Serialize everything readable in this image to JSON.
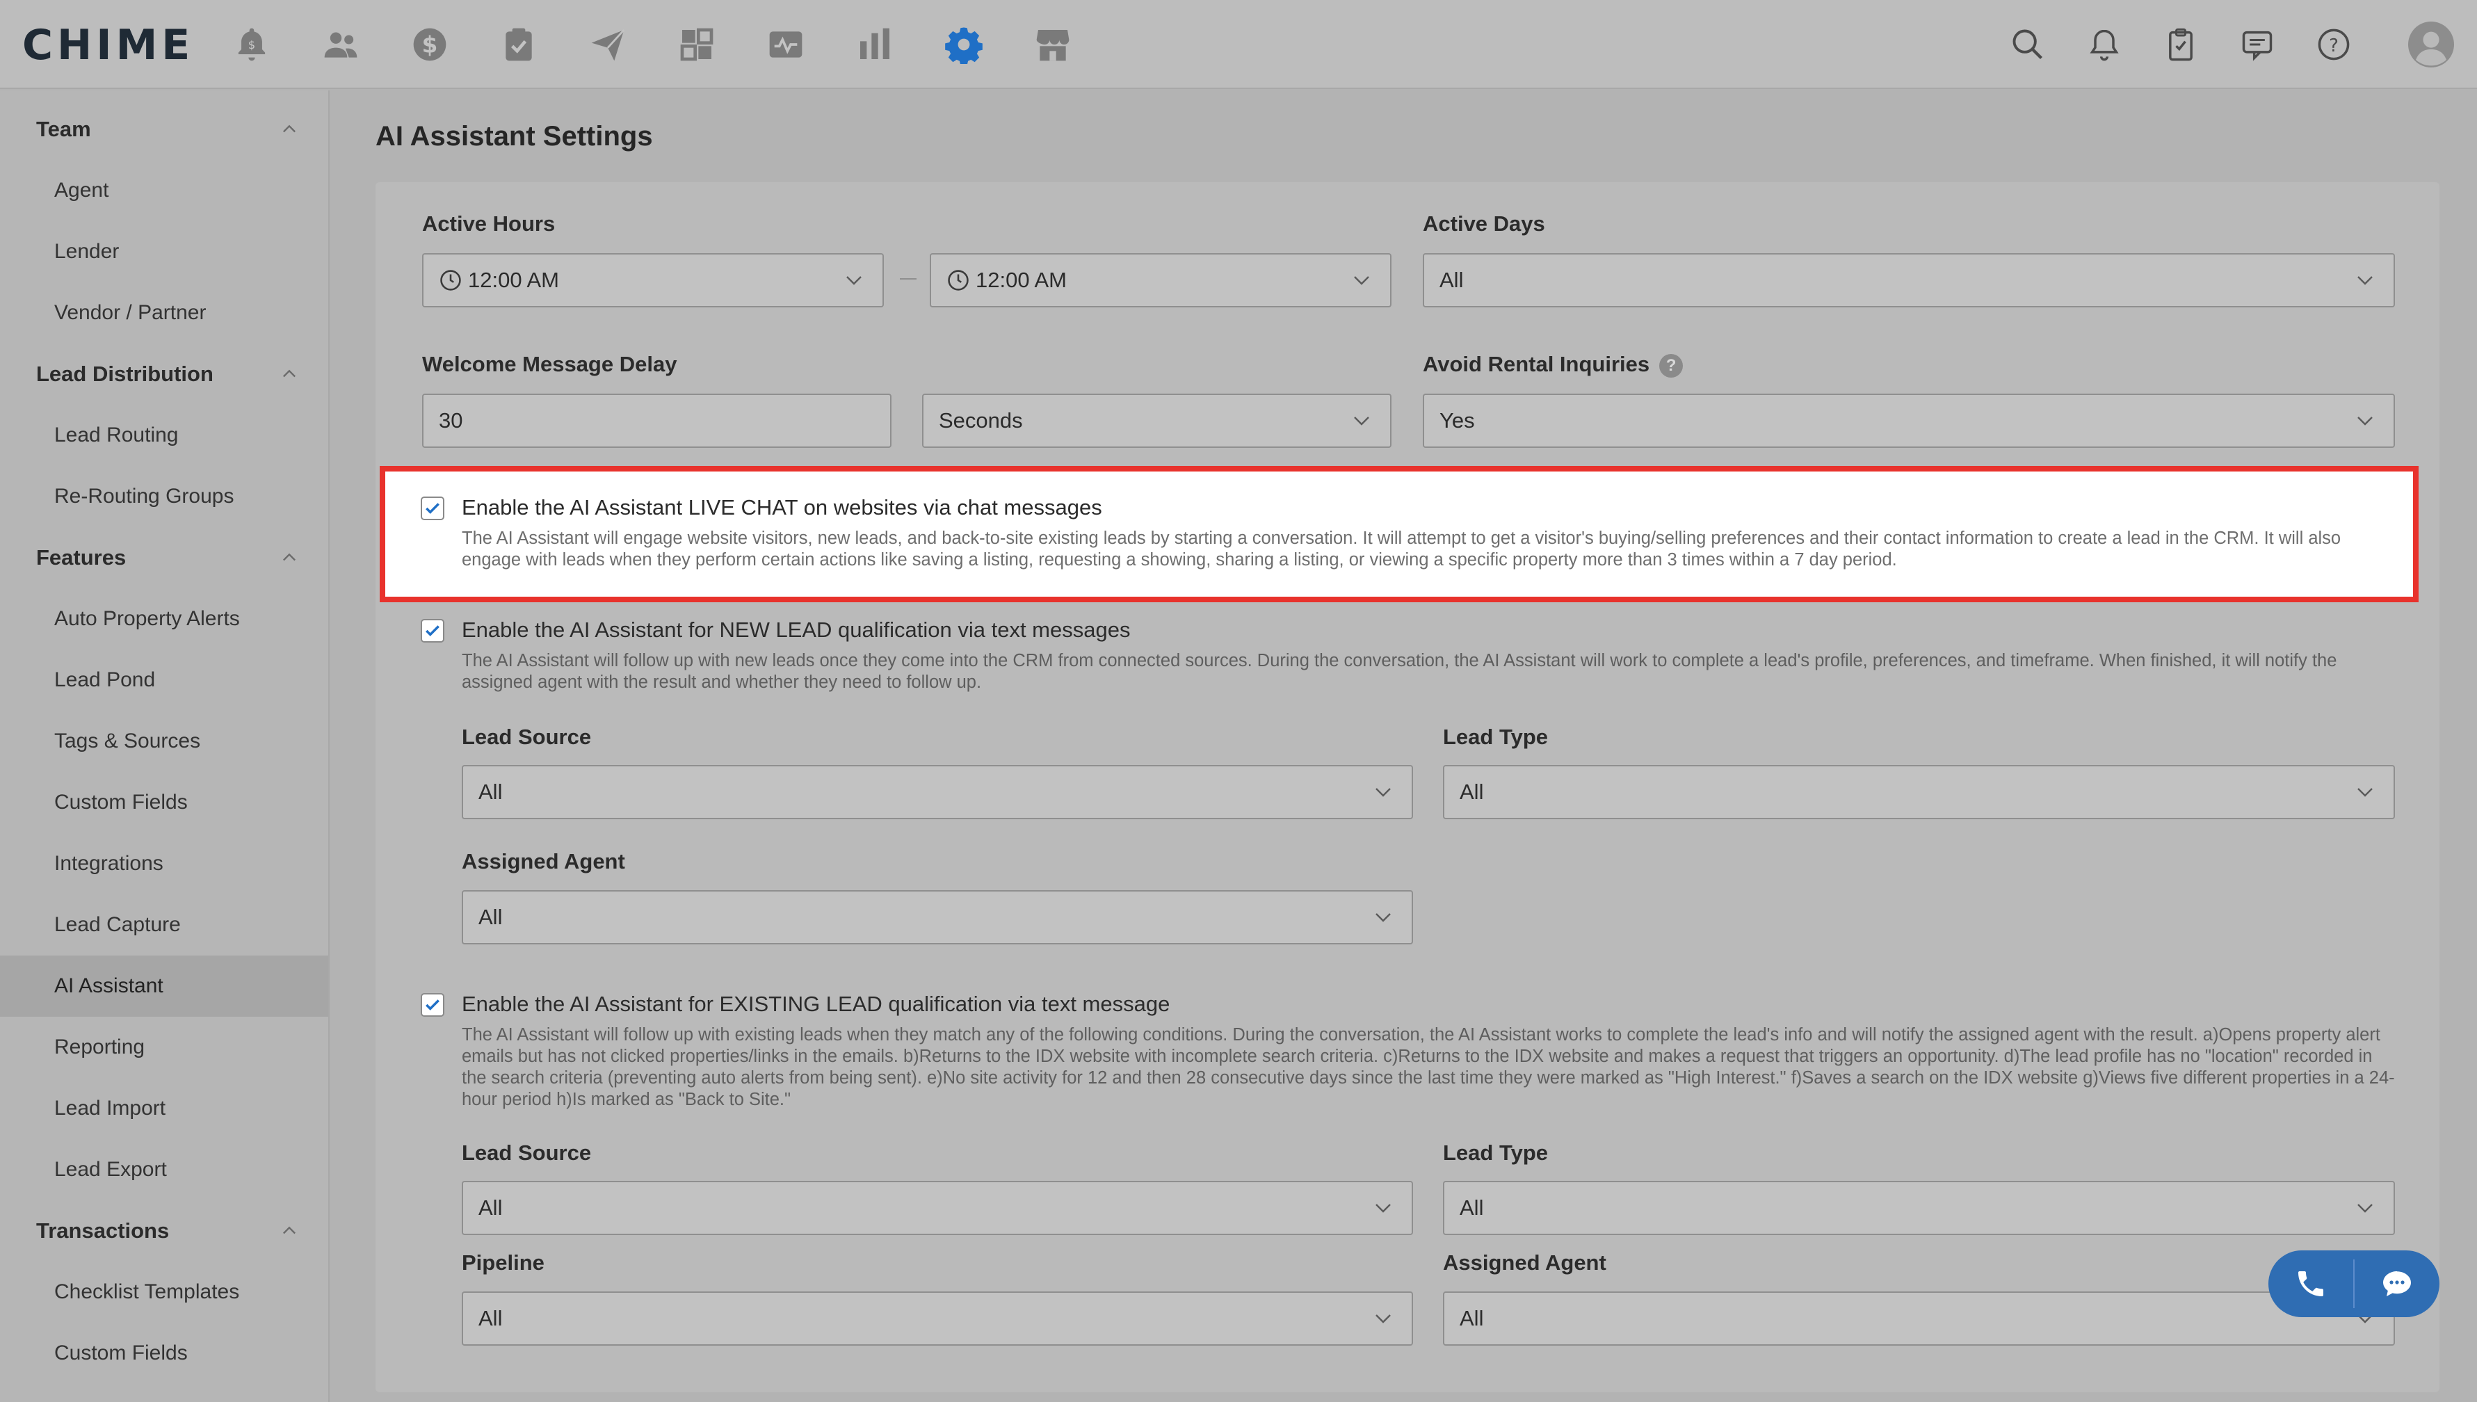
{
  "app": {
    "logo": "CHIME"
  },
  "top_nav": {
    "icons": [
      "bell-dollar-icon",
      "people-icon",
      "dollar-icon",
      "clipboard-check-icon",
      "send-icon",
      "dashboard-icon",
      "activity-icon",
      "bar-chart-icon",
      "gear-icon",
      "store-icon"
    ],
    "active": "gear-icon",
    "right_icons": [
      "search-icon",
      "notification-bell-icon",
      "task-clipboard-icon",
      "message-icon",
      "help-icon",
      "avatar"
    ]
  },
  "sidebar": {
    "sections": [
      {
        "title": "Team",
        "items": [
          "Agent",
          "Lender",
          "Vendor / Partner"
        ]
      },
      {
        "title": "Lead Distribution",
        "items": [
          "Lead Routing",
          "Re-Routing Groups"
        ]
      },
      {
        "title": "Features",
        "items": [
          "Auto Property Alerts",
          "Lead Pond",
          "Tags & Sources",
          "Custom Fields",
          "Integrations",
          "Lead Capture",
          "AI Assistant",
          "Reporting",
          "Lead Import",
          "Lead Export"
        ]
      },
      {
        "title": "Transactions",
        "items": [
          "Checklist Templates",
          "Custom Fields"
        ]
      }
    ],
    "active_item": "AI Assistant"
  },
  "page": {
    "title": "AI Assistant Settings",
    "active_hours": {
      "label": "Active Hours",
      "start": "12:00 AM",
      "end": "12:00 AM"
    },
    "active_days": {
      "label": "Active Days",
      "value": "All"
    },
    "welcome_delay": {
      "label": "Welcome Message Delay",
      "value": "30",
      "unit": "Seconds"
    },
    "avoid_rental": {
      "label": "Avoid Rental Inquiries",
      "help": "?",
      "value": "Yes"
    },
    "live_chat": {
      "checked": true,
      "title": "Enable the AI Assistant LIVE CHAT on websites via chat messages",
      "desc": "The AI Assistant will engage website visitors, new leads, and back-to-site existing leads by starting a conversation. It will attempt to get a visitor's buying/selling preferences and their contact information to create a lead in the CRM. It will also engage with leads when they perform certain actions like saving a listing, requesting a showing, sharing a listing, or viewing a specific property more than 3 times within a 7 day period."
    },
    "new_lead": {
      "checked": true,
      "title": "Enable the AI Assistant for NEW LEAD qualification via text messages",
      "desc": "The AI Assistant will follow up with new leads once they come into the CRM from connected sources. During the conversation, the AI Assistant will work to complete a lead's profile, preferences, and timeframe. When finished, it will notify the assigned agent with the result and whether they need to follow up.",
      "lead_source": {
        "label": "Lead Source",
        "value": "All"
      },
      "lead_type": {
        "label": "Lead Type",
        "value": "All"
      },
      "assigned_agent": {
        "label": "Assigned Agent",
        "value": "All"
      }
    },
    "existing_lead": {
      "checked": true,
      "title": "Enable the AI Assistant for EXISTING LEAD qualification via text message",
      "desc": "The AI Assistant will follow up with existing leads when they match any of the following conditions. During the conversation, the AI Assistant works to complete the lead's info and will notify the assigned agent with the result. a)Opens property alert emails but has not clicked properties/links in the emails. b)Returns to the IDX website with incomplete search criteria. c)Returns to the IDX website and makes a request that triggers an opportunity. d)The lead profile has no \"location\" recorded in the search criteria (preventing auto alerts from being sent). e)No site activity for 12 and then 28 consecutive days since the last time they were marked as \"High Interest.\" f)Saves a search on the IDX website g)Views five different properties in a 24-hour period h)Is marked as \"Back to Site.\"",
      "lead_source": {
        "label": "Lead Source",
        "value": "All"
      },
      "lead_type": {
        "label": "Lead Type",
        "value": "All"
      },
      "pipeline": {
        "label": "Pipeline",
        "value": "All"
      },
      "assigned_agent": {
        "label": "Assigned Agent",
        "value": "All"
      }
    }
  },
  "fab": {
    "icons": [
      "phone-icon",
      "chat-icon"
    ]
  },
  "colors": {
    "accent": "#1f6fc6",
    "highlight_border": "#e8322c",
    "fab": "#2f6db3"
  }
}
